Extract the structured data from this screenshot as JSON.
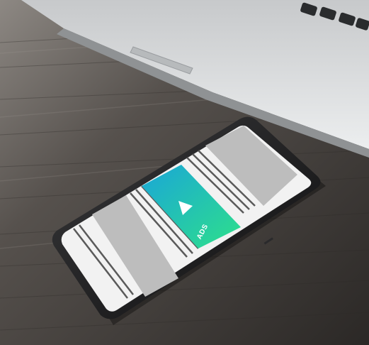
{
  "image": {
    "ad_badge": "ADS",
    "play_icon": "play-triangle-icon",
    "colors": {
      "table_wood": "#3e3a37",
      "laptop_silver": "#d9dbdd",
      "phone_body": "#1c1c1e",
      "screen": "#f2f2f2",
      "placeholder_block": "#bdbdbd",
      "text_lines": "#5a5a5a",
      "ad_gradient_start": "#1aa6d8",
      "ad_gradient_end": "#2ee08a"
    }
  }
}
